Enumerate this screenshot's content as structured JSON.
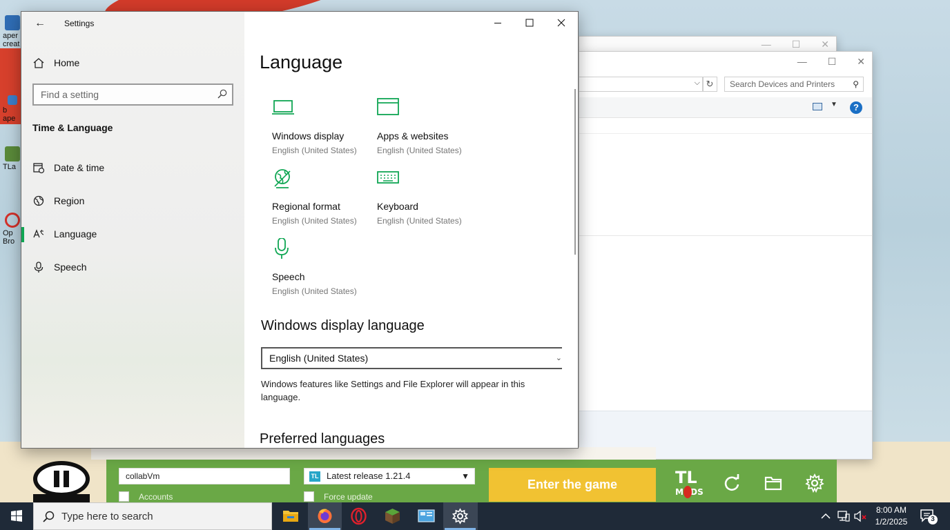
{
  "desktop": {
    "icon_labels": [
      "aper",
      "creat",
      "b",
      "ape",
      "TLa",
      "Op",
      "Bro"
    ]
  },
  "devices_window": {
    "search_placeholder": "Search Devices and Printers"
  },
  "launcher": {
    "username": "collabVm",
    "accounts_label": "Accounts",
    "version": "Latest release 1.21.4",
    "force_update_label": "Force update",
    "enter_button": "Enter the game",
    "logo_big": "TL",
    "logo_small": "MODS"
  },
  "settings": {
    "window_title": "Settings",
    "home_label": "Home",
    "search_placeholder": "Find a setting",
    "section_title": "Time & Language",
    "nav_items": [
      {
        "label": "Date & time",
        "icon": "calendar-clock-icon"
      },
      {
        "label": "Region",
        "icon": "globe-icon"
      },
      {
        "label": "Language",
        "icon": "language-icon"
      },
      {
        "label": "Speech",
        "icon": "microphone-icon"
      }
    ],
    "active_nav": "Language",
    "page_title": "Language",
    "tiles": [
      {
        "name": "Windows display",
        "sub": "English (United States)",
        "icon": "monitor-icon"
      },
      {
        "name": "Apps & websites",
        "sub": "English (United States)",
        "icon": "window-icon"
      },
      {
        "name": "Regional format",
        "sub": "English (United States)",
        "icon": "globe-format-icon"
      },
      {
        "name": "Keyboard",
        "sub": "English (United States)",
        "icon": "keyboard-icon"
      },
      {
        "name": "Speech",
        "sub": "English (United States)",
        "icon": "microphone-icon"
      }
    ],
    "display_language_heading": "Windows display language",
    "display_language_value": "English (United States)",
    "display_language_desc": "Windows features like Settings and File Explorer will appear in this language.",
    "preferred_heading": "Preferred languages",
    "accent_color": "#0fa653"
  },
  "taskbar": {
    "search_placeholder": "Type here to search",
    "time": "8:00 AM",
    "date": "1/2/2025",
    "notification_count": "3",
    "apps": [
      "file-explorer-icon",
      "firefox-icon",
      "opera-icon",
      "minecraft-icon",
      "control-panel-icon",
      "settings-icon"
    ]
  }
}
